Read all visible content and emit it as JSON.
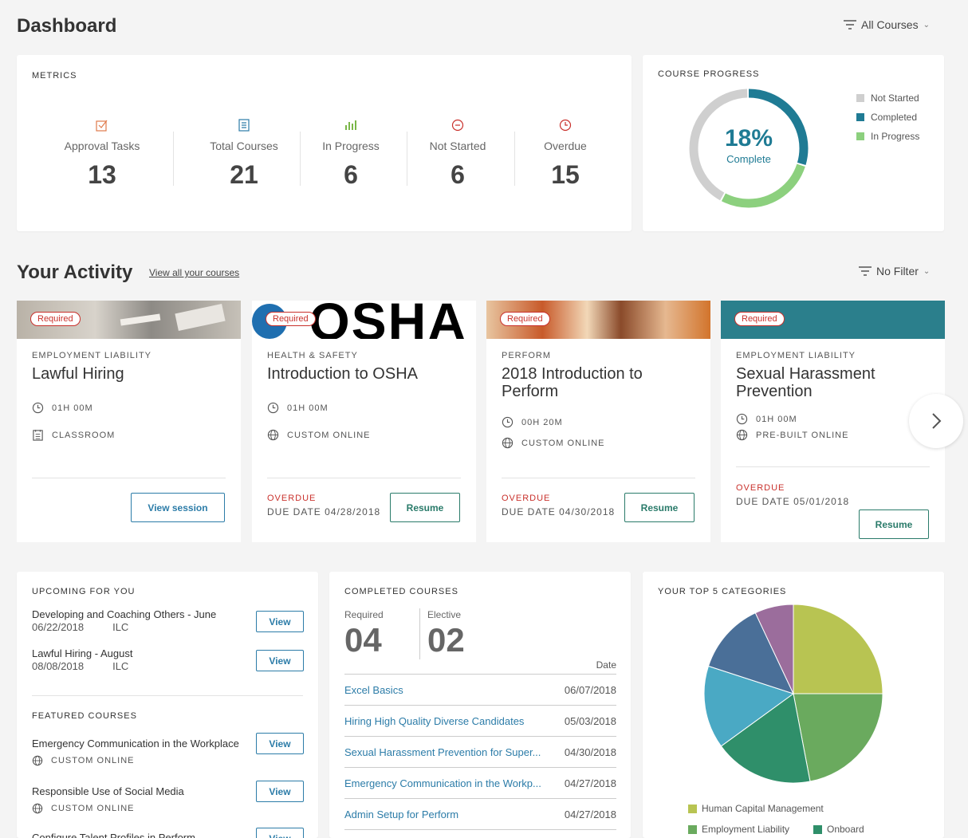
{
  "header": {
    "title": "Dashboard",
    "filter_label": "All Courses"
  },
  "metrics": {
    "title": "METRICS",
    "items": [
      {
        "label": "Approval Tasks",
        "value": "13",
        "icon": "approval-check-icon",
        "color": "#e07a4b"
      },
      {
        "label": "Total Courses",
        "value": "21",
        "icon": "courses-list-icon",
        "color": "#2c7ca8"
      },
      {
        "label": "In Progress",
        "value": "6",
        "icon": "progress-bars-icon",
        "color": "#7ab648"
      },
      {
        "label": "Not Started",
        "value": "6",
        "icon": "minus-circle-icon",
        "color": "#c9312c"
      },
      {
        "label": "Overdue",
        "value": "15",
        "icon": "clock-icon",
        "color": "#c9312c"
      }
    ]
  },
  "course_progress": {
    "title": "COURSE PROGRESS",
    "percent_text": "18%",
    "complete_label": "Complete",
    "legend": [
      {
        "label": "Not Started",
        "color": "#cfcfcf"
      },
      {
        "label": "Completed",
        "color": "#1f7b94"
      },
      {
        "label": "In Progress",
        "color": "#8cd07e"
      }
    ],
    "segments": [
      {
        "name": "Completed",
        "fraction": 0.3,
        "color": "#1f7b94"
      },
      {
        "name": "In Progress",
        "fraction": 0.28,
        "color": "#8cd07e"
      },
      {
        "name": "Not Started",
        "fraction": 0.42,
        "color": "#cfcfcf"
      }
    ]
  },
  "activity": {
    "title": "Your Activity",
    "view_all_link": "View all your courses",
    "filter_label": "No Filter",
    "courses": [
      {
        "badge": "Required",
        "category": "EMPLOYMENT LIABILITY",
        "title": "Lawful Hiring",
        "duration": "01H 00M",
        "type": "CLASSROOM",
        "overdue": "",
        "due": "",
        "button": "View session"
      },
      {
        "badge": "Required",
        "category": "HEALTH & SAFETY",
        "title": "Introduction to OSHA",
        "duration": "01H 00M",
        "type": "CUSTOM ONLINE",
        "overdue": "OVERDUE",
        "due": "DUE DATE 04/28/2018",
        "button": "Resume",
        "banner_text": "OSHA"
      },
      {
        "badge": "Required",
        "category": "PERFORM",
        "title": "2018 Introduction to Perform",
        "duration": "00H 20M",
        "type": "CUSTOM ONLINE",
        "overdue": "OVERDUE",
        "due": "DUE DATE 04/30/2018",
        "button": "Resume"
      },
      {
        "badge": "Required",
        "category": "EMPLOYMENT LIABILITY",
        "title": "Sexual Harassment Prevention",
        "duration": "01H 00M",
        "type": "PRE-BUILT ONLINE",
        "overdue": "OVERDUE",
        "due": "DUE DATE 05/01/2018",
        "button": "Resume"
      }
    ]
  },
  "upcoming": {
    "title": "UPCOMING FOR YOU",
    "items": [
      {
        "title": "Developing and Coaching Others - June",
        "date": "06/22/2018",
        "type": "ILC",
        "button": "View"
      },
      {
        "title": "Lawful Hiring - August",
        "date": "08/08/2018",
        "type": "ILC",
        "button": "View"
      }
    ]
  },
  "featured": {
    "title": "FEATURED COURSES",
    "items": [
      {
        "title": "Emergency Communication in the Workplace",
        "type": "CUSTOM ONLINE",
        "button": "View"
      },
      {
        "title": "Responsible Use of Social Media",
        "type": "CUSTOM ONLINE",
        "button": "View"
      },
      {
        "title": "Configure Talent Profiles in Perform",
        "button": "View"
      }
    ]
  },
  "completed": {
    "title": "COMPLETED COURSES",
    "required_label": "Required",
    "required_value": "04",
    "elective_label": "Elective",
    "elective_value": "02",
    "date_header": "Date",
    "rows": [
      {
        "name": "Excel Basics",
        "date": "06/07/2018"
      },
      {
        "name": "Hiring High Quality Diverse Candidates",
        "date": "05/03/2018"
      },
      {
        "name": "Sexual Harassment Prevention for Super...",
        "date": "04/30/2018"
      },
      {
        "name": "Emergency Communication in the Workp...",
        "date": "04/27/2018"
      },
      {
        "name": "Admin Setup for Perform",
        "date": "04/27/2018"
      }
    ]
  },
  "top_categories": {
    "title": "YOUR TOP 5 CATEGORIES",
    "legend": [
      {
        "label": "Human Capital Management",
        "color": "#b8c452"
      },
      {
        "label": "Employment Liability",
        "color": "#6aaa5e"
      },
      {
        "label": "Onboard",
        "color": "#2f8f6a"
      }
    ],
    "slices": [
      {
        "value": 0.25,
        "color": "#b8c452"
      },
      {
        "value": 0.22,
        "color": "#6aaa5e"
      },
      {
        "value": 0.18,
        "color": "#2f8f6a"
      },
      {
        "value": 0.15,
        "color": "#4aa9c4"
      },
      {
        "value": 0.13,
        "color": "#4a6f98"
      },
      {
        "value": 0.07,
        "color": "#9b6d9c"
      }
    ]
  }
}
